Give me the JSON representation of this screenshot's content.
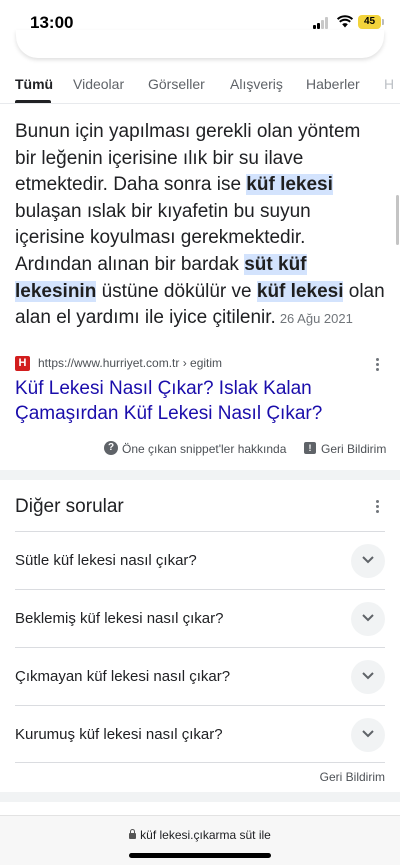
{
  "status": {
    "time": "13:00",
    "battery": "45"
  },
  "tabs": [
    "Tümü",
    "Videolar",
    "Görseller",
    "Alışveriş",
    "Haberler",
    "H"
  ],
  "snippet": {
    "parts": [
      {
        "text": "Bunun için yapılması gerekli olan yöntem bir leğenin içerisine ılık bir su ilave etmektedir. Daha sonra ise ",
        "highlight": false
      },
      {
        "text": "küf lekesi",
        "highlight": true
      },
      {
        "text": " bulaşan ıslak bir kıyafetin bu suyun içerisine koyulması gerekmektedir. Ardından alınan bir bardak ",
        "highlight": false
      },
      {
        "text": "süt küf lekesinin",
        "highlight": true
      },
      {
        "text": " üstüne dökülür ve ",
        "highlight": false
      },
      {
        "text": "küf lekesi",
        "highlight": true
      },
      {
        "text": " olan alan el yardımı ile iyice çitilenir.",
        "highlight": false
      }
    ],
    "date": "26 Ağu 2021"
  },
  "source": {
    "favicon_letter": "H",
    "url": "https://www.hurriyet.com.tr › egitim",
    "title": "Küf Lekesi Nasıl Çıkar? Islak Kalan Çamaşırdan Küf Lekesi Nasıl Çıkar?"
  },
  "snippet_footer": {
    "about": "Öne çıkan snippet'ler hakkında",
    "feedback": "Geri Bildirim"
  },
  "paa": {
    "title": "Diğer sorular",
    "questions": [
      "Sütle küf lekesi nasıl çıkar?",
      "Beklemiş küf lekesi nasıl çıkar?",
      "Çıkmayan küf lekesi nasıl çıkar?",
      "Kurumuş küf lekesi nasıl çıkar?"
    ],
    "feedback": "Geri Bildirim"
  },
  "bottom_bar": {
    "url": "küf lekesi.çıkarma süt ile"
  }
}
